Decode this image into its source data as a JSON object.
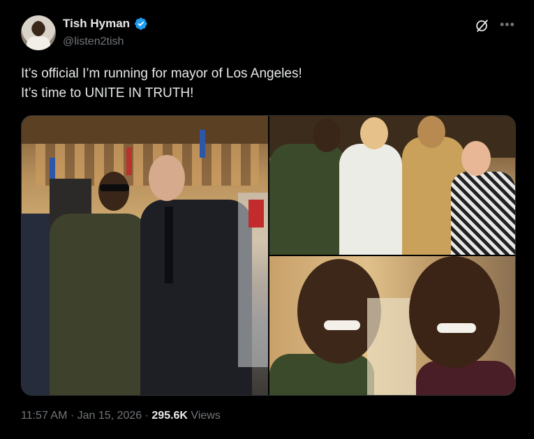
{
  "author": {
    "name": "Tish Hyman",
    "handle": "@listen2tish",
    "verified_color": "#1d9bf0"
  },
  "tweet": {
    "lines": [
      "It’s official I’m running for mayor of Los Angeles!",
      "It’s time to UNITE IN TRUTH!"
    ]
  },
  "meta": {
    "time": "11:57 AM",
    "sep1": " · ",
    "date": "Jan 15, 2026",
    "sep2": " · ",
    "views_count": "295.6K",
    "views_label": " Views"
  },
  "icons": {
    "grok": "grok-icon",
    "more": "more-icon",
    "verified": "verified-badge-icon"
  },
  "colors": {
    "background": "#000000",
    "text": "#e7e9ea",
    "secondary": "#71767b",
    "verified": "#1d9bf0"
  }
}
